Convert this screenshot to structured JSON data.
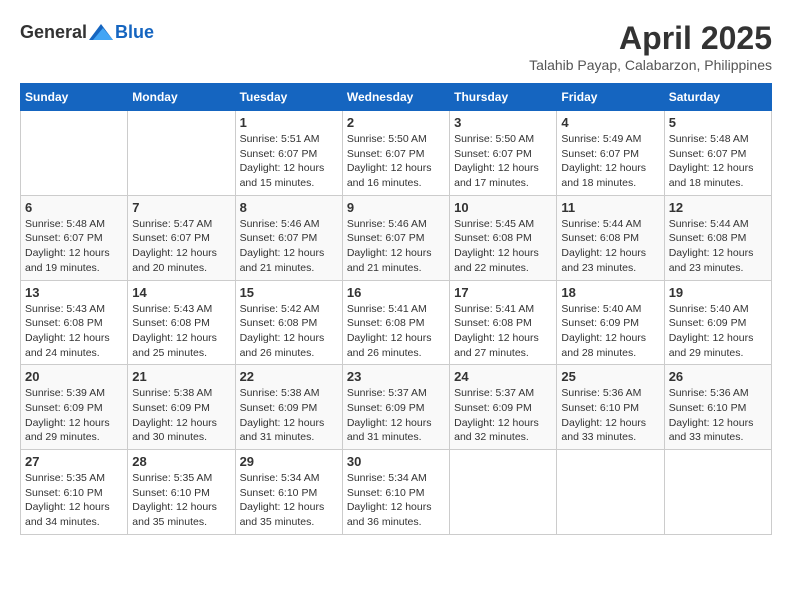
{
  "logo": {
    "general": "General",
    "blue": "Blue"
  },
  "title": {
    "month_year": "April 2025",
    "location": "Talahib Payap, Calabarzon, Philippines"
  },
  "header": {
    "days": [
      "Sunday",
      "Monday",
      "Tuesday",
      "Wednesday",
      "Thursday",
      "Friday",
      "Saturday"
    ]
  },
  "weeks": [
    [
      {
        "day": "",
        "info": ""
      },
      {
        "day": "",
        "info": ""
      },
      {
        "day": "1",
        "info": "Sunrise: 5:51 AM\nSunset: 6:07 PM\nDaylight: 12 hours and 15 minutes."
      },
      {
        "day": "2",
        "info": "Sunrise: 5:50 AM\nSunset: 6:07 PM\nDaylight: 12 hours and 16 minutes."
      },
      {
        "day": "3",
        "info": "Sunrise: 5:50 AM\nSunset: 6:07 PM\nDaylight: 12 hours and 17 minutes."
      },
      {
        "day": "4",
        "info": "Sunrise: 5:49 AM\nSunset: 6:07 PM\nDaylight: 12 hours and 18 minutes."
      },
      {
        "day": "5",
        "info": "Sunrise: 5:48 AM\nSunset: 6:07 PM\nDaylight: 12 hours and 18 minutes."
      }
    ],
    [
      {
        "day": "6",
        "info": "Sunrise: 5:48 AM\nSunset: 6:07 PM\nDaylight: 12 hours and 19 minutes."
      },
      {
        "day": "7",
        "info": "Sunrise: 5:47 AM\nSunset: 6:07 PM\nDaylight: 12 hours and 20 minutes."
      },
      {
        "day": "8",
        "info": "Sunrise: 5:46 AM\nSunset: 6:07 PM\nDaylight: 12 hours and 21 minutes."
      },
      {
        "day": "9",
        "info": "Sunrise: 5:46 AM\nSunset: 6:07 PM\nDaylight: 12 hours and 21 minutes."
      },
      {
        "day": "10",
        "info": "Sunrise: 5:45 AM\nSunset: 6:08 PM\nDaylight: 12 hours and 22 minutes."
      },
      {
        "day": "11",
        "info": "Sunrise: 5:44 AM\nSunset: 6:08 PM\nDaylight: 12 hours and 23 minutes."
      },
      {
        "day": "12",
        "info": "Sunrise: 5:44 AM\nSunset: 6:08 PM\nDaylight: 12 hours and 23 minutes."
      }
    ],
    [
      {
        "day": "13",
        "info": "Sunrise: 5:43 AM\nSunset: 6:08 PM\nDaylight: 12 hours and 24 minutes."
      },
      {
        "day": "14",
        "info": "Sunrise: 5:43 AM\nSunset: 6:08 PM\nDaylight: 12 hours and 25 minutes."
      },
      {
        "day": "15",
        "info": "Sunrise: 5:42 AM\nSunset: 6:08 PM\nDaylight: 12 hours and 26 minutes."
      },
      {
        "day": "16",
        "info": "Sunrise: 5:41 AM\nSunset: 6:08 PM\nDaylight: 12 hours and 26 minutes."
      },
      {
        "day": "17",
        "info": "Sunrise: 5:41 AM\nSunset: 6:08 PM\nDaylight: 12 hours and 27 minutes."
      },
      {
        "day": "18",
        "info": "Sunrise: 5:40 AM\nSunset: 6:09 PM\nDaylight: 12 hours and 28 minutes."
      },
      {
        "day": "19",
        "info": "Sunrise: 5:40 AM\nSunset: 6:09 PM\nDaylight: 12 hours and 29 minutes."
      }
    ],
    [
      {
        "day": "20",
        "info": "Sunrise: 5:39 AM\nSunset: 6:09 PM\nDaylight: 12 hours and 29 minutes."
      },
      {
        "day": "21",
        "info": "Sunrise: 5:38 AM\nSunset: 6:09 PM\nDaylight: 12 hours and 30 minutes."
      },
      {
        "day": "22",
        "info": "Sunrise: 5:38 AM\nSunset: 6:09 PM\nDaylight: 12 hours and 31 minutes."
      },
      {
        "day": "23",
        "info": "Sunrise: 5:37 AM\nSunset: 6:09 PM\nDaylight: 12 hours and 31 minutes."
      },
      {
        "day": "24",
        "info": "Sunrise: 5:37 AM\nSunset: 6:09 PM\nDaylight: 12 hours and 32 minutes."
      },
      {
        "day": "25",
        "info": "Sunrise: 5:36 AM\nSunset: 6:10 PM\nDaylight: 12 hours and 33 minutes."
      },
      {
        "day": "26",
        "info": "Sunrise: 5:36 AM\nSunset: 6:10 PM\nDaylight: 12 hours and 33 minutes."
      }
    ],
    [
      {
        "day": "27",
        "info": "Sunrise: 5:35 AM\nSunset: 6:10 PM\nDaylight: 12 hours and 34 minutes."
      },
      {
        "day": "28",
        "info": "Sunrise: 5:35 AM\nSunset: 6:10 PM\nDaylight: 12 hours and 35 minutes."
      },
      {
        "day": "29",
        "info": "Sunrise: 5:34 AM\nSunset: 6:10 PM\nDaylight: 12 hours and 35 minutes."
      },
      {
        "day": "30",
        "info": "Sunrise: 5:34 AM\nSunset: 6:10 PM\nDaylight: 12 hours and 36 minutes."
      },
      {
        "day": "",
        "info": ""
      },
      {
        "day": "",
        "info": ""
      },
      {
        "day": "",
        "info": ""
      }
    ]
  ]
}
